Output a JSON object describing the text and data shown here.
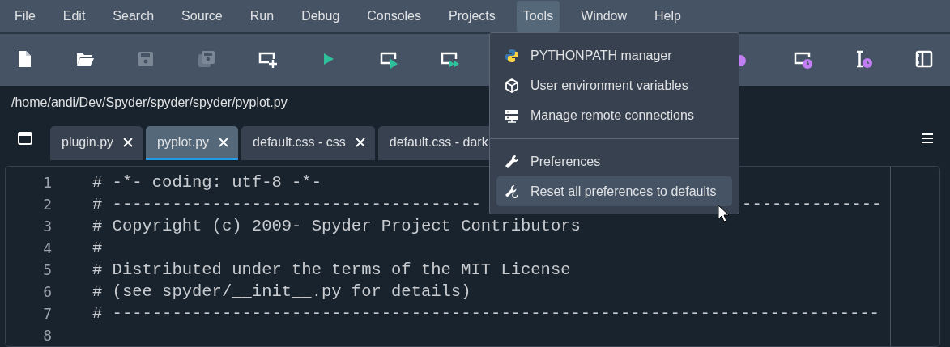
{
  "menu_bar": [
    {
      "label": "File",
      "selected": false
    },
    {
      "label": "Edit",
      "selected": false
    },
    {
      "label": "Search",
      "selected": false
    },
    {
      "label": "Source",
      "selected": false
    },
    {
      "label": "Run",
      "selected": false
    },
    {
      "label": "Debug",
      "selected": false
    },
    {
      "label": "Consoles",
      "selected": false
    },
    {
      "label": "Projects",
      "selected": false
    },
    {
      "label": "Tools",
      "selected": true
    },
    {
      "label": "Window",
      "selected": false
    },
    {
      "label": "Help",
      "selected": false
    }
  ],
  "toolbar": {
    "left": [
      {
        "kind": "new-file",
        "disabled": false
      },
      {
        "kind": "open",
        "disabled": false
      },
      {
        "kind": "save",
        "disabled": true
      },
      {
        "kind": "save-all",
        "disabled": true
      },
      {
        "kind": "new-cell",
        "disabled": false
      },
      {
        "kind": "run",
        "disabled": false
      },
      {
        "kind": "run-cell",
        "disabled": false
      },
      {
        "kind": "run-cell-advance",
        "disabled": false
      }
    ],
    "right": [
      {
        "kind": "debug",
        "disabled": false
      },
      {
        "kind": "profile-cell",
        "disabled": false
      },
      {
        "kind": "profile-line",
        "disabled": false
      },
      {
        "kind": "maximize",
        "disabled": false
      }
    ]
  },
  "path": "/home/andi/Dev/Spyder/spyder/spyder/pyplot.py",
  "tabs": [
    {
      "label": "plugin.py",
      "selected": false,
      "closable": true
    },
    {
      "label": "pyplot.py",
      "selected": true,
      "closable": true
    },
    {
      "label": "default.css - css",
      "selected": false,
      "closable": true
    },
    {
      "label": "default.css - dark",
      "selected": false,
      "closable": false
    }
  ],
  "editor": {
    "lines": [
      {
        "number": "1",
        "code": "# -*- coding: utf-8 -*-"
      },
      {
        "number": "2",
        "code": "# -------------------------------------",
        "code_right": "--------------"
      },
      {
        "number": "3",
        "code": "# Copyright (c) 2009- Spyder Project Contributors"
      },
      {
        "number": "4",
        "code": "#"
      },
      {
        "number": "5",
        "code": "# Distributed under the terms of the MIT License"
      },
      {
        "number": "6",
        "code": "# (see spyder/__init__.py for details)"
      },
      {
        "number": "7",
        "code": "# -----------------------------------------------------------------------------"
      },
      {
        "number": "8"
      }
    ]
  },
  "tools_menu": {
    "groups": [
      [
        {
          "label": "PYTHONPATH manager",
          "kind": "python",
          "selected": false
        },
        {
          "label": "User environment variables",
          "kind": "cube",
          "selected": false
        },
        {
          "label": "Manage remote connections",
          "kind": "server",
          "selected": false
        }
      ],
      [
        {
          "label": "Preferences",
          "kind": "wrench",
          "selected": false
        },
        {
          "label": "Reset all preferences to defaults",
          "kind": "wrench-reset",
          "selected": true
        }
      ]
    ]
  }
}
